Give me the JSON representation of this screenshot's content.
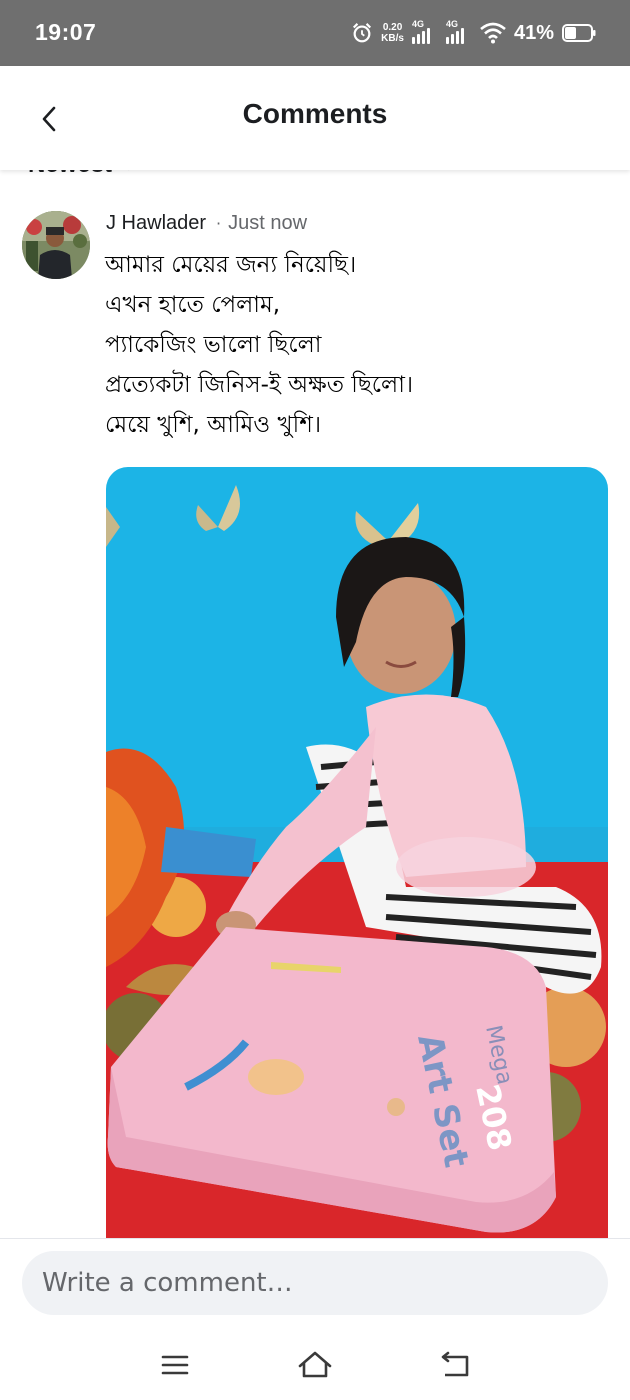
{
  "status_bar": {
    "time": "19:07",
    "net_speed_value": "0.20",
    "net_speed_unit": "KB/s",
    "signal1_label": "4G",
    "signal2_label": "4G",
    "battery": "41%",
    "icons": [
      "alarm-icon",
      "signal-icon",
      "signal-icon",
      "wifi-icon",
      "battery-icon"
    ]
  },
  "header": {
    "title": "Comments",
    "back_icon": "chevron-left-icon"
  },
  "sort": {
    "label": "Newest",
    "icon": "caret-down-icon"
  },
  "comment": {
    "author": "J Hawlader",
    "separator": "·",
    "time": "Just now",
    "lines": [
      "আমার মেয়ের জন্য নিয়েছি।",
      "এখন হাতে পেলাম,",
      "প্যাকেজিং ভালো ছিলো",
      "প্রত্যেকটা জিনিস-ই অক্ষত ছিলো।",
      "মেয়ে খুশি, আমিও খুশি।"
    ],
    "photo_box_text": [
      "Mega",
      "Art Set",
      "208"
    ]
  },
  "composer": {
    "placeholder": "Write a comment…"
  },
  "nav": {
    "icons": [
      "menu-icon",
      "home-icon",
      "back-icon"
    ]
  },
  "colors": {
    "status_bar": "#6f6f6f",
    "wall": "#1cb4e6",
    "text": "#1c1e21",
    "muted": "#65676b",
    "input_bg": "#f0f2f5"
  }
}
